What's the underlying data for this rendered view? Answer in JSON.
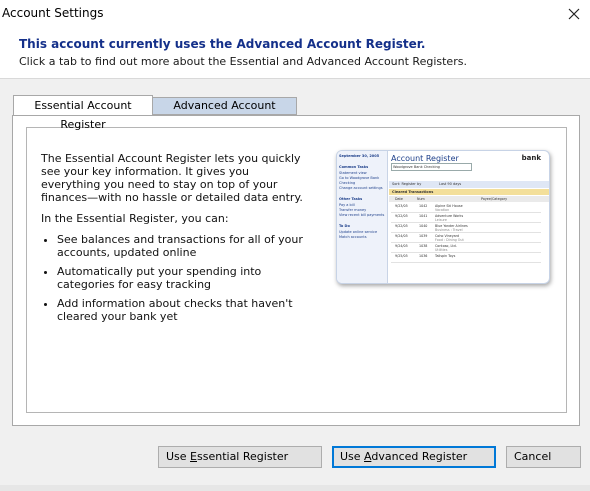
{
  "window": {
    "title": "Account Settings"
  },
  "header": {
    "headline": "This account currently uses the Advanced Account Register.",
    "subline": "Click a tab to find out more about the Essential and Advanced Account Registers."
  },
  "tabs": [
    {
      "label": "Essential Account Register",
      "active": true
    },
    {
      "label": "Advanced Account Register",
      "active": false
    }
  ],
  "essential": {
    "intro": "The Essential Account Register lets you quickly see your key information. It gives you everything you need to stay on top of your finances—with no hassle or detailed data entry.",
    "lead": "In the Essential Register, you can:",
    "bullets": [
      "See balances and transactions for all of your accounts, updated online",
      "Automatically put your spending into categories for easy tracking",
      "Add information about checks that haven't cleared your bank yet"
    ]
  },
  "preview": {
    "date": "September 30, 2005",
    "title": "Account Register",
    "bank": "bank",
    "account": "Woodgrove Bank Checking",
    "sidebar": [
      "Common Tasks",
      "Statement view",
      "Go to Woodgrove Bank",
      "Checking",
      "Change account settings",
      "Other Tasks",
      "Pay a bill",
      "Transfer money",
      "View recent bill payments",
      "To Do",
      "Update online service",
      "Match accounts"
    ],
    "toolbar": [
      "Sort: Register by",
      "Last 90 days"
    ],
    "section": "Cleared Transactions",
    "columns": [
      "Date",
      "Num",
      "Payee/Category"
    ],
    "rows": [
      [
        "9/23/05",
        "1042",
        "Alpine Ski House",
        "Vacation"
      ],
      [
        "9/22/05",
        "1041",
        "Adventure Works",
        "Leisure"
      ],
      [
        "9/22/05",
        "1040",
        "Blue Yonder Airlines",
        "Business : Travel"
      ],
      [
        "9/24/05",
        "1039",
        "Coho Vineyard",
        "Food : Dining Out"
      ],
      [
        "9/24/05",
        "1038",
        "Contoso, Ltd.",
        "Utilities"
      ],
      [
        "9/25/05",
        "1036",
        "Tailspin Toys",
        ""
      ]
    ]
  },
  "buttons": {
    "essential": {
      "prefix": "Use ",
      "mnemonic": "E",
      "suffix": "ssential Register"
    },
    "advanced": {
      "prefix": "Use ",
      "mnemonic": "A",
      "suffix": "dvanced Register"
    },
    "cancel": "Cancel"
  }
}
